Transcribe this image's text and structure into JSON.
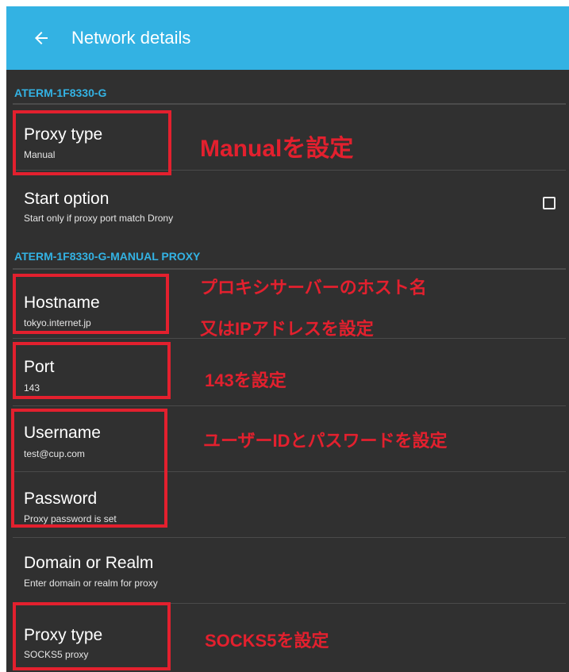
{
  "appbar": {
    "title": "Network details"
  },
  "sections": [
    {
      "label": "ATERM-1F8330-G"
    },
    {
      "label": "ATERM-1F8330-G-MANUAL PROXY"
    }
  ],
  "settings": {
    "proxy_type": {
      "title": "Proxy type",
      "value": "Manual"
    },
    "start_option": {
      "title": "Start option",
      "summary": "Start only if proxy port match Drony",
      "checked": false
    },
    "hostname": {
      "title": "Hostname",
      "value": "tokyo.internet.jp"
    },
    "port": {
      "title": "Port",
      "value": "143"
    },
    "username": {
      "title": "Username",
      "value": "test@cup.com"
    },
    "password": {
      "title": "Password",
      "summary": "Proxy password is set"
    },
    "domain": {
      "title": "Domain or Realm",
      "summary": "Enter domain or realm for proxy"
    },
    "proxy_type_2": {
      "title": "Proxy type",
      "value": "SOCKS5 proxy"
    }
  },
  "annotations": {
    "manual": "Manualを設定",
    "hostname_line1": "プロキシサーバーのホスト名",
    "hostname_line2": "又はIPアドレスを設定",
    "port": "143を設定",
    "user_pass": "ユーザーIDとパスワードを設定",
    "socks5": "SOCKS5を設定"
  },
  "colors": {
    "appbar": "#33b2e3",
    "background": "#303030",
    "section": "#33b2e3",
    "annotation": "#e3202e"
  },
  "icons": {
    "back": "arrow-left-icon",
    "checkbox": "checkbox-unchecked-icon"
  }
}
